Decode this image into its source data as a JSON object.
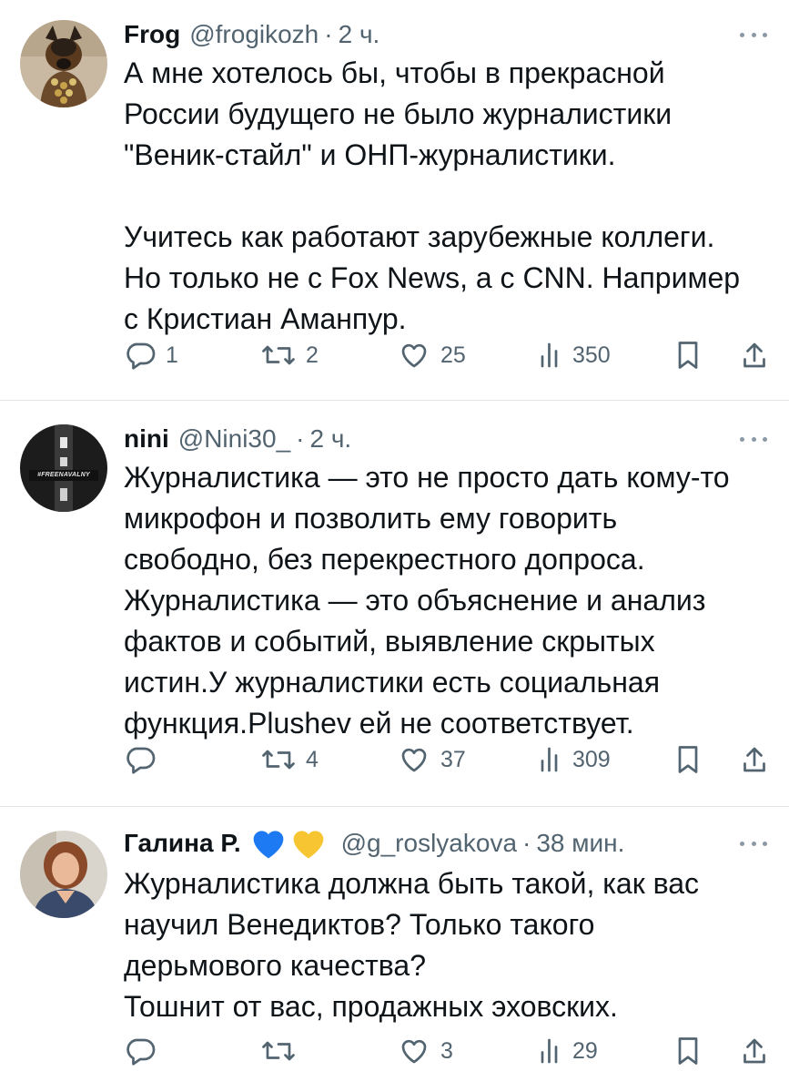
{
  "tweets": [
    {
      "name": "Frog",
      "handle": "@frogikozh",
      "separator": "·",
      "time": "2 ч.",
      "text": "А мне хотелось бы, чтобы в прекрасной\nРоссии будущего не было журналистики\n\"Веник-стайл\" и ОНП-журналистики.\n\nУчитесь как работают зарубежные коллеги.\nНо только не с Fox News, а с CNN. Например\nс Кристиан Аманпур.",
      "replies": "1",
      "retweets": "2",
      "likes": "25",
      "views": "350"
    },
    {
      "name": "nini",
      "handle": "@Nini30_",
      "separator": "·",
      "time": "2 ч.",
      "avatar_text": "#FREENAVALNY",
      "text": "Журналистика — это не просто дать кому-то\nмикрофон и позволить ему говорить\nсвободно, без перекрестного допроса.\nЖурналистика — это объяснение и анализ\nфактов и событий, выявление скрытых\nистин.У журналистики есть социальная\nфункция.Plushev ей не соответствует.",
      "replies": "",
      "retweets": "4",
      "likes": "37",
      "views": "309"
    },
    {
      "name": "Галина Р.",
      "handle": "@g_roslyakova",
      "separator": "·",
      "time": "38 мин.",
      "text": "Журналистика должна быть такой, как вас\nнаучил Венедиктов? Только такого\nдерьмового качества?\nТошнит от вас, продажных эховских.",
      "replies": "",
      "retweets": "",
      "likes": "3",
      "views": "29"
    }
  ],
  "colors": {
    "text": "#0f1419",
    "secondary": "#536471",
    "divider": "#e1e5e8",
    "heart_blue": "#1d7af2",
    "heart_yellow": "#f7c531"
  },
  "icons": [
    "reply-icon",
    "retweet-icon",
    "like-icon",
    "views-icon",
    "bookmark-icon",
    "share-icon",
    "more-icon",
    "blue-heart-icon",
    "yellow-heart-icon"
  ]
}
